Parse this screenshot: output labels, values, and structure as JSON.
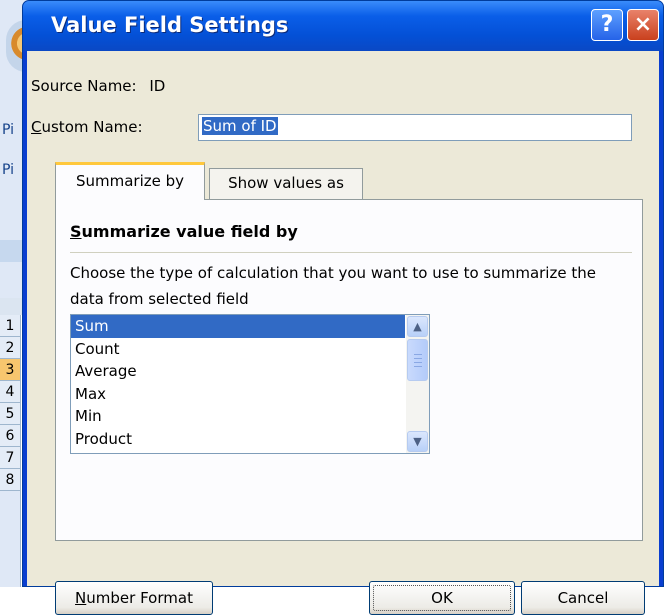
{
  "background_app": {
    "fragments": [
      "Pi",
      "Pi"
    ],
    "row_numbers": [
      "1",
      "2",
      "3",
      "4",
      "5",
      "6",
      "7",
      "8"
    ],
    "active_row": "3"
  },
  "dialog": {
    "title": "Value Field Settings",
    "help_glyph": "?",
    "close_glyph": "×",
    "source_label": "Source Name:",
    "source_value": "ID",
    "custom_name_label_underlined": "C",
    "custom_name_label_rest": "ustom Name:",
    "custom_name_value": "Sum of ID",
    "tabs": [
      {
        "label": "Summarize by",
        "active": true
      },
      {
        "label": "Show values as",
        "active": false
      }
    ],
    "section_title_underlined": "S",
    "section_title_rest": "ummarize value field by",
    "description": "Choose the type of calculation that you want to use to summarize the data from selected field",
    "calc_options": [
      "Sum",
      "Count",
      "Average",
      "Max",
      "Min",
      "Product"
    ],
    "selected_option": "Sum",
    "buttons": {
      "number_format_underlined": "N",
      "number_format_rest": "umber Format",
      "ok": "OK",
      "cancel": "Cancel"
    }
  },
  "icons": {
    "scroll_up": "up-arrow-icon",
    "scroll_down": "down-arrow-icon"
  },
  "colors": {
    "titlebar": "#0a5ee8",
    "selection": "#316ac5",
    "tab_highlight": "#ffc83c",
    "dialog_face": "#ece9d8"
  }
}
